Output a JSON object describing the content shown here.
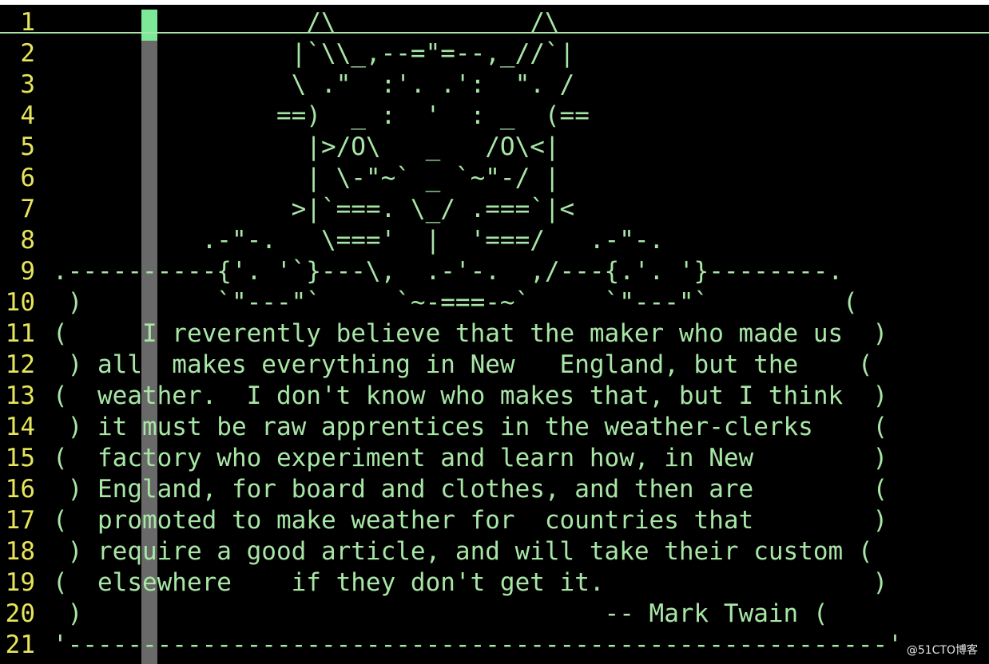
{
  "editor": {
    "lines": [
      {
        "num": "1",
        "text": "                 /\\             /\\"
      },
      {
        "num": "2",
        "text": "                |`\\\\_,--=\"=--,_//`|"
      },
      {
        "num": "3",
        "text": "                \\ .\"  :'. .':  \". /"
      },
      {
        "num": "4",
        "text": "               ==)  _ :  '  : _  (=="
      },
      {
        "num": "5",
        "text": "                 |>/O\\   _   /O\\<|"
      },
      {
        "num": "6",
        "text": "                 | \\-\"~` _ `~\"-/ |"
      },
      {
        "num": "7",
        "text": "                >|`===. \\_/ .===`|<"
      },
      {
        "num": "8",
        "text": "          .-\"-.   \\==='  |  '===/   .-\"-."
      },
      {
        "num": "9",
        "text": ".----------{'. '`}---\\,  .-'-.  ,/---{.'. '}--------."
      },
      {
        "num": "10",
        "text": " )         `\"---\"`     `~-===-~`     `\"---\"`         ("
      },
      {
        "num": "11",
        "text": "(     I reverently believe that the maker who made us  )"
      },
      {
        "num": "12",
        "text": " ) all  makes everything in New   England, but the    ("
      },
      {
        "num": "13",
        "text": "(  weather.  I don't know who makes that, but I think  )"
      },
      {
        "num": "14",
        "text": " ) it must be raw apprentices in the weather-clerks    ("
      },
      {
        "num": "15",
        "text": "(  factory who experiment and learn how, in New        )"
      },
      {
        "num": "16",
        "text": " ) England, for board and clothes, and then are        ("
      },
      {
        "num": "17",
        "text": "(  promoted to make weather for  countries that        )"
      },
      {
        "num": "18",
        "text": " ) require a good article, and will take their custom ("
      },
      {
        "num": "19",
        "text": "(  elsewhere    if they don't get it.                  )"
      },
      {
        "num": "20",
        "text": " )                                   -- Mark Twain ("
      },
      {
        "num": "21",
        "text": "'-------------------------------------------------------'"
      }
    ]
  },
  "watermark": "@51CTO博客",
  "colors": {
    "text": "#a8e6a6",
    "line_number": "#e7e55a",
    "cursor": "#7ee899",
    "background": "#000000"
  }
}
